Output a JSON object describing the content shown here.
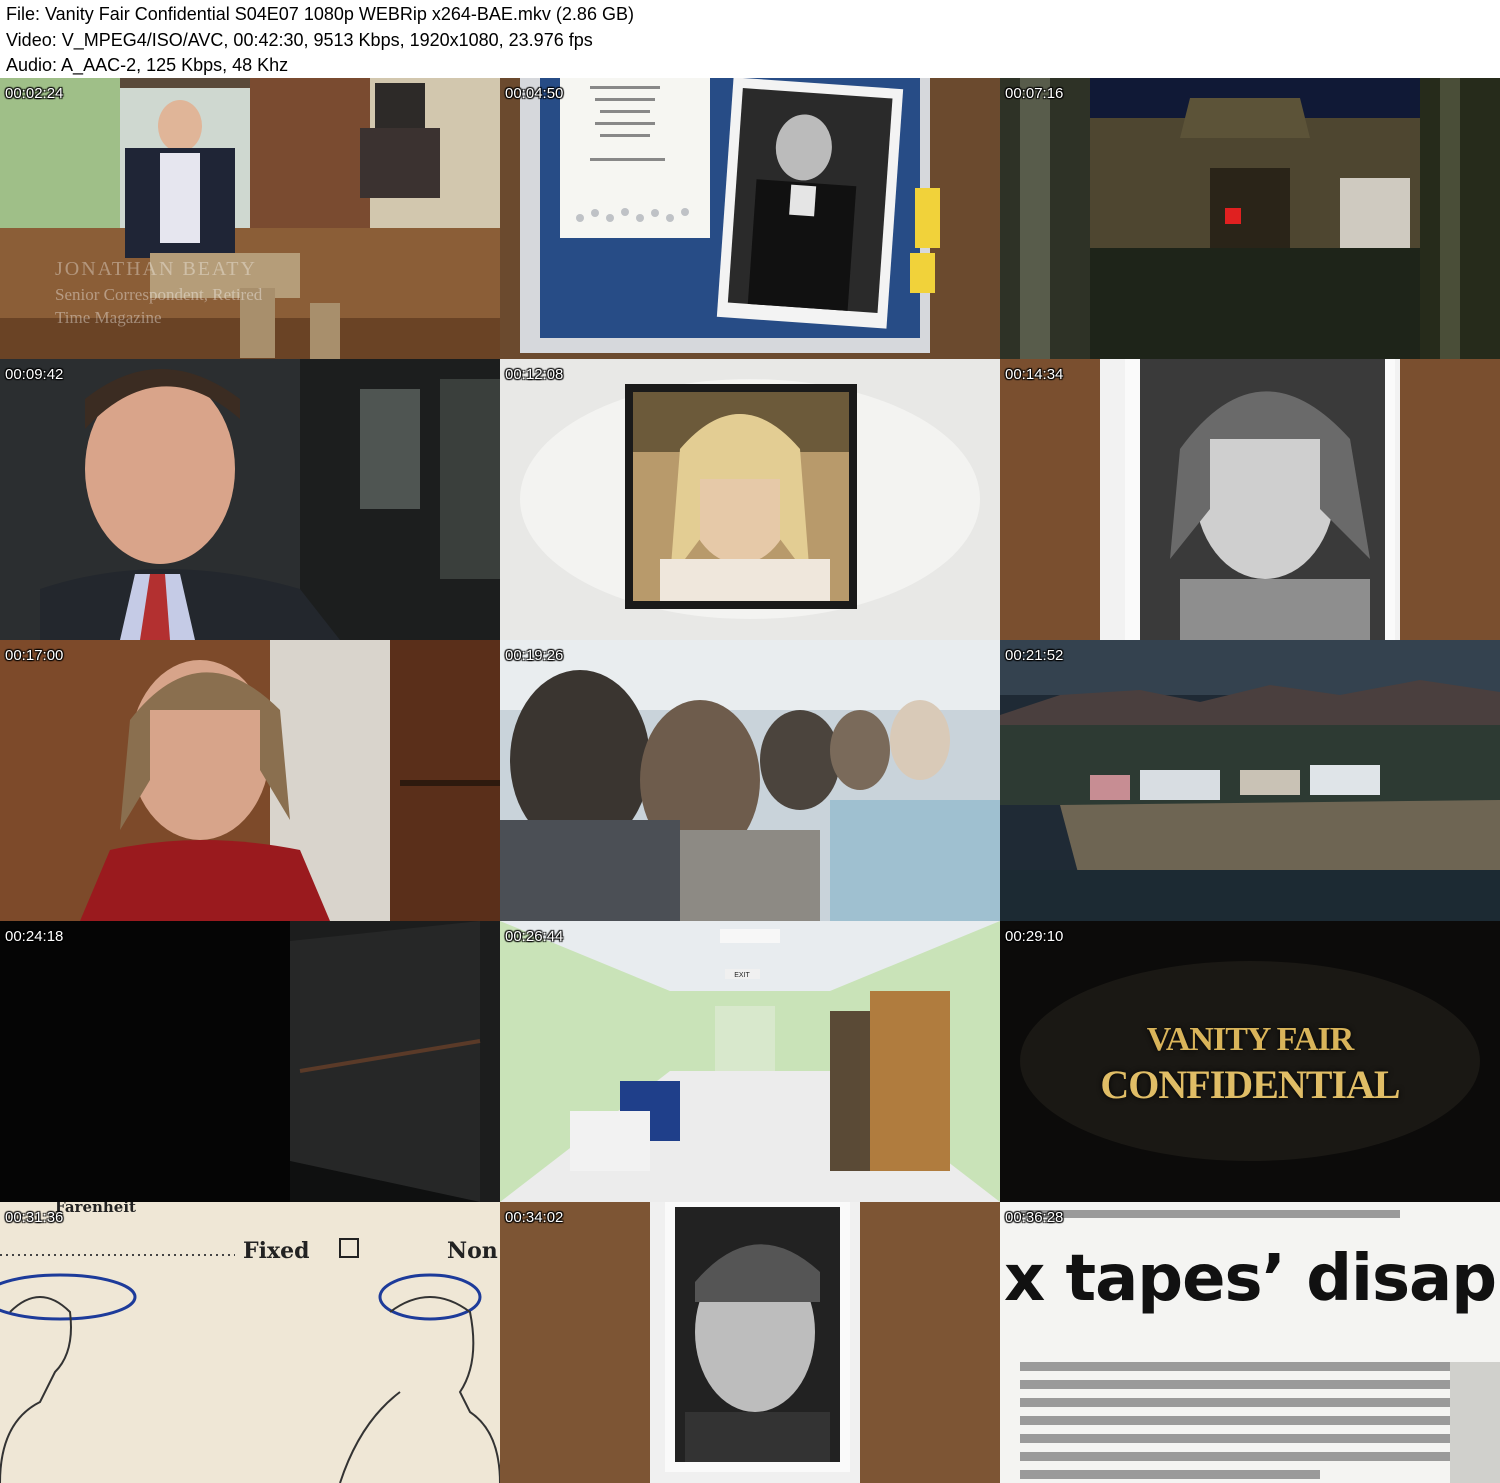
{
  "header": {
    "file_line": "File: Vanity Fair Confidential S04E07 1080p WEBRip x264-BAE.mkv (2.86 GB)",
    "video_line": "Video: V_MPEG4/ISO/AVC, 00:42:30, 9513 Kbps, 1920x1080, 23.976 fps",
    "audio_line": "Audio: A_AAC-2, 125 Kbps, 48 Khz"
  },
  "thumbnails": [
    {
      "timestamp": "00:02:24",
      "scene": "office-interview",
      "caption_name": "JONATHAN BEATY",
      "caption_title": "Senior Correspondent, Retired",
      "caption_org": "Time Magazine"
    },
    {
      "timestamp": "00:04:50",
      "scene": "invitation-and-photo"
    },
    {
      "timestamp": "00:07:16",
      "scene": "house-at-night"
    },
    {
      "timestamp": "00:09:42",
      "scene": "man-interview"
    },
    {
      "timestamp": "00:12:08",
      "scene": "framed-portrait"
    },
    {
      "timestamp": "00:14:34",
      "scene": "bw-portrait-woman"
    },
    {
      "timestamp": "00:17:00",
      "scene": "woman-interview"
    },
    {
      "timestamp": "00:19:26",
      "scene": "crowd"
    },
    {
      "timestamp": "00:21:52",
      "scene": "coastal-aerial"
    },
    {
      "timestamp": "00:24:18",
      "scene": "dark-hallway"
    },
    {
      "timestamp": "00:26:44",
      "scene": "hospital-corridor",
      "exit_sign": "EXIT"
    },
    {
      "timestamp": "00:29:10",
      "scene": "title-card",
      "title_line1": "VANITY FAIR",
      "title_line2": "CONFIDENTIAL"
    },
    {
      "timestamp": "00:31:36",
      "scene": "medical-form",
      "form_heading": "Farenheit",
      "form_fixed": "Fixed",
      "form_non": "Non"
    },
    {
      "timestamp": "00:34:02",
      "scene": "bw-portrait-man"
    },
    {
      "timestamp": "00:36:28",
      "scene": "newspaper-clipping",
      "headline": "x tapes’ disap"
    }
  ]
}
